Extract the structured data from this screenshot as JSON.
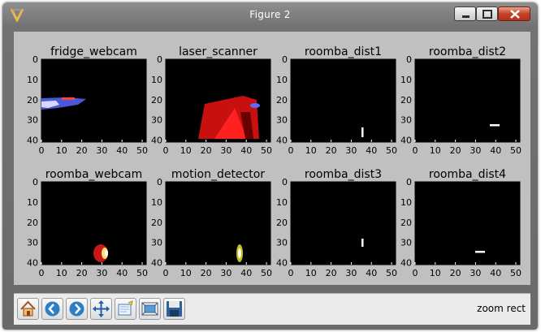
{
  "window": {
    "title": "Figure 2"
  },
  "figure": {
    "axes": [
      {
        "id": "fridge_webcam",
        "title": "fridge_webcam"
      },
      {
        "id": "laser_scanner",
        "title": "laser_scanner"
      },
      {
        "id": "roomba_dist1",
        "title": "roomba_dist1"
      },
      {
        "id": "roomba_dist2",
        "title": "roomba_dist2"
      },
      {
        "id": "roomba_webcam",
        "title": "roomba_webcam"
      },
      {
        "id": "motion_detector",
        "title": "motion_detector"
      },
      {
        "id": "roomba_dist3",
        "title": "roomba_dist3"
      },
      {
        "id": "roomba_dist4",
        "title": "roomba_dist4"
      }
    ],
    "xticks": [
      "0",
      "10",
      "20",
      "30",
      "40",
      "50"
    ],
    "yticks": [
      "0",
      "10",
      "20",
      "30",
      "40"
    ]
  },
  "toolbar": {
    "buttons": [
      {
        "name": "home-button",
        "icon": "home-icon"
      },
      {
        "name": "back-button",
        "icon": "back-arrow-icon"
      },
      {
        "name": "forward-button",
        "icon": "forward-arrow-icon"
      },
      {
        "name": "pan-button",
        "icon": "pan-icon"
      },
      {
        "name": "zoom-rect-button",
        "icon": "zoom-rect-icon"
      },
      {
        "name": "subplots-button",
        "icon": "subplots-icon"
      },
      {
        "name": "save-button",
        "icon": "save-icon"
      }
    ],
    "mode_text": "zoom rect"
  }
}
